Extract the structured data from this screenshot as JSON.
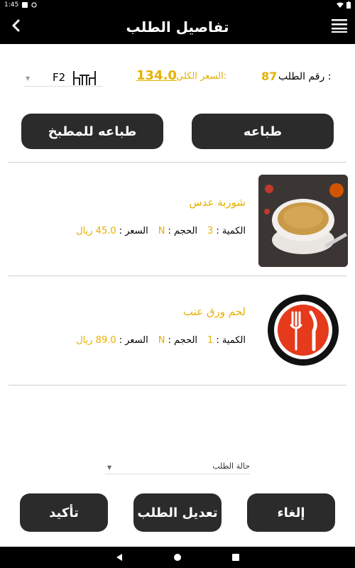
{
  "status_bar": {
    "time": "1:45"
  },
  "app_bar": {
    "title": "تفاصيل الطلب"
  },
  "summary": {
    "table_number": "F2",
    "total_value": "134.0",
    "total_label": "السعر الكلي:",
    "order_number": "87",
    "order_label": "رقم الطلب :"
  },
  "actions_top": {
    "print_label": "طباعه",
    "print_kitchen_label": "طباعه للمطبخ"
  },
  "items": [
    {
      "name": "شوربة عدس",
      "quantity_label": "الكمية :",
      "quantity": "3",
      "size_label": "الحجم :",
      "size": "N",
      "price_label": "السعر :",
      "price": "45.0 ريال"
    },
    {
      "name": "لحم ورق عنب",
      "quantity_label": "الكمية :",
      "quantity": "1",
      "size_label": "الحجم :",
      "size": "N",
      "price_label": "السعر :",
      "price": "89.0 ريال"
    }
  ],
  "order_status": {
    "label": "حالة الطلب"
  },
  "actions_bottom": {
    "cancel_label": "إلغاء",
    "edit_label": "تعديل الطلب",
    "confirm_label": "تأكيد"
  },
  "colors": {
    "accent": "#e6b000",
    "button": "#2b2b2b",
    "bar": "#000000"
  }
}
